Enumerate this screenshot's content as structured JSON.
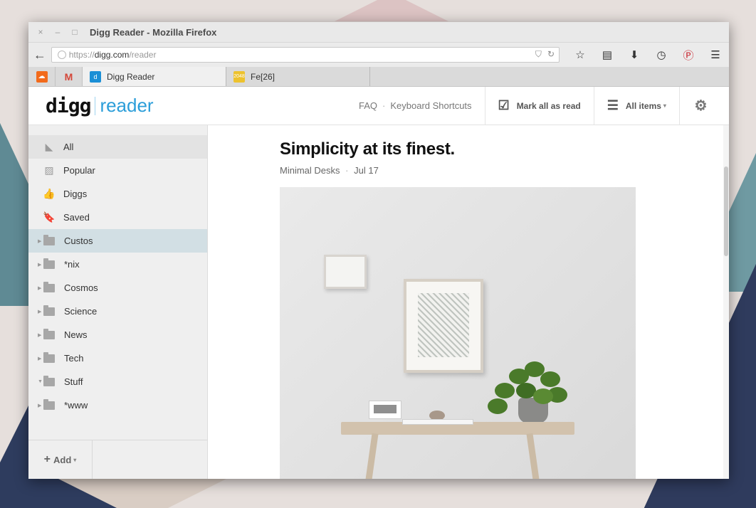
{
  "window": {
    "title": "Digg Reader - Mozilla Firefox",
    "controls": [
      "×",
      "–",
      "□"
    ]
  },
  "navbar": {
    "back_icon": "←",
    "url_scheme": "https://",
    "url_host": "digg.com",
    "url_path": "/reader",
    "url_right_icons": [
      "pocket-icon",
      "reload-icon"
    ],
    "icons": [
      "star-icon",
      "reading-list-icon",
      "download-icon",
      "history-icon",
      "pinterest-icon",
      "menu-icon"
    ]
  },
  "tabs": {
    "pinned": [
      "soundcloud",
      "gmail"
    ],
    "items": [
      {
        "label": "Digg Reader",
        "favicon": "digg",
        "active": true
      },
      {
        "label": "Fe[26]",
        "favicon": "2048",
        "active": false
      }
    ],
    "favicon_2048_text": "2048"
  },
  "header": {
    "logo_digg": "digg",
    "logo_reader": "reader",
    "faq": "FAQ",
    "separator": "·",
    "shortcuts": "Keyboard Shortcuts",
    "mark_all": "Mark all as read",
    "all_items": "All items",
    "dropdown_caret": "▾"
  },
  "sidebar": {
    "primary": [
      {
        "label": "All",
        "icon": "rss-icon"
      },
      {
        "label": "Popular",
        "icon": "chart-icon"
      },
      {
        "label": "Diggs",
        "icon": "thumb-icon"
      },
      {
        "label": "Saved",
        "icon": "bookmark-icon"
      }
    ],
    "folders": [
      {
        "label": "Custos"
      },
      {
        "label": "*nix"
      },
      {
        "label": "Cosmos"
      },
      {
        "label": "Science"
      },
      {
        "label": "News"
      },
      {
        "label": "Tech"
      },
      {
        "label": "Stuff"
      },
      {
        "label": "*www"
      }
    ],
    "add_label": "Add",
    "add_plus": "+",
    "add_caret": "▾"
  },
  "article": {
    "title": "Simplicity at its finest.",
    "source": "Minimal Desks",
    "separator": "·",
    "date": "Jul 17"
  },
  "colors": {
    "accent": "#2c9ed9",
    "selected_folder": "#d2dfe4",
    "pinterest": "#c8232c"
  }
}
